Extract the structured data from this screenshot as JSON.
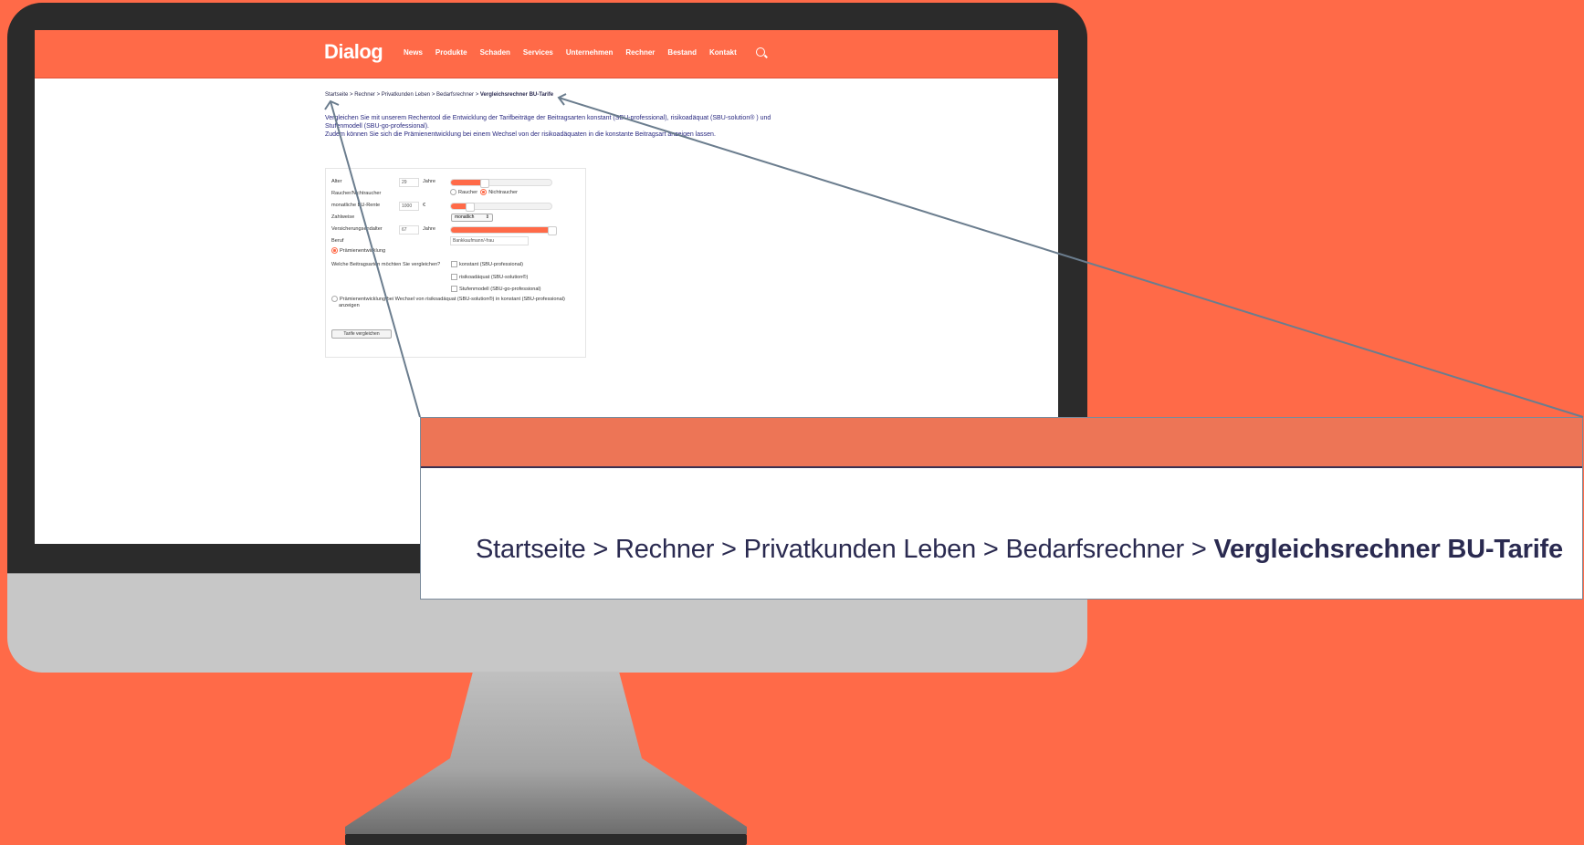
{
  "site": {
    "logo": "Dialog",
    "nav": [
      "News",
      "Produkte",
      "Schaden",
      "Services",
      "Unternehmen",
      "Rechner",
      "Bestand",
      "Kontakt"
    ]
  },
  "breadcrumb": {
    "items": [
      "Startseite",
      "Rechner",
      "Privatkunden Leben",
      "Bedarfsrechner"
    ],
    "current": "Vergleichsrechner BU-Tarife",
    "sep": ">"
  },
  "intro": {
    "line1": "Vergleichen Sie mit unserem Rechentool die Entwicklung der Tarifbeiträge der Beitragsarten konstant (SBU-professional), risikoadäquat (SBU-solution® ) und Stufenmodell (SBU-go-professional).",
    "line2": "Zudem können Sie sich die Prämienentwicklung bei einem Wechsel von der risikoadäquaten in die konstante Beitragsart anzeigen lassen."
  },
  "form": {
    "alter_label": "Alter",
    "alter_value": "29",
    "alter_unit": "Jahre",
    "alter_slider": 0.33,
    "raucher_label": "Raucher/Nichtraucher",
    "raucher_opt1": "Raucher",
    "raucher_opt2": "Nichtraucher",
    "rente_label": "monatliche BU-Rente",
    "rente_value": "1000",
    "rente_unit": "€",
    "rente_slider": 0.18,
    "zahlweise_label": "Zahlweise",
    "zahlweise_value": "monatlich",
    "endalter_label": "Versicherungsendalter",
    "endalter_value": "67",
    "endalter_unit": "Jahre",
    "endalter_slider": 0.97,
    "beruf_label": "Beruf",
    "beruf_value": "Bankkaufmann/-frau",
    "praemie_radio": "Prämienentwicklung",
    "vergleich_label": "Welche Beitragsarten möchten Sie vergleichen?",
    "opt_konstant": "konstant (SBU-professional)",
    "opt_risiko": "risikoadäquat (SBU-solution®)",
    "opt_stufen": "Stufenmodell (SBU-go-professional)",
    "wechsel_line1": "Prämienentwicklung bei Wechsel von risikoadäquat (SBU-solution®) in konstant (SBU-professional)",
    "wechsel_line2": "anzeigen",
    "button": "Tarife vergleichen"
  },
  "colors": {
    "brand": "#ff6a48",
    "text": "#2a2a50"
  }
}
